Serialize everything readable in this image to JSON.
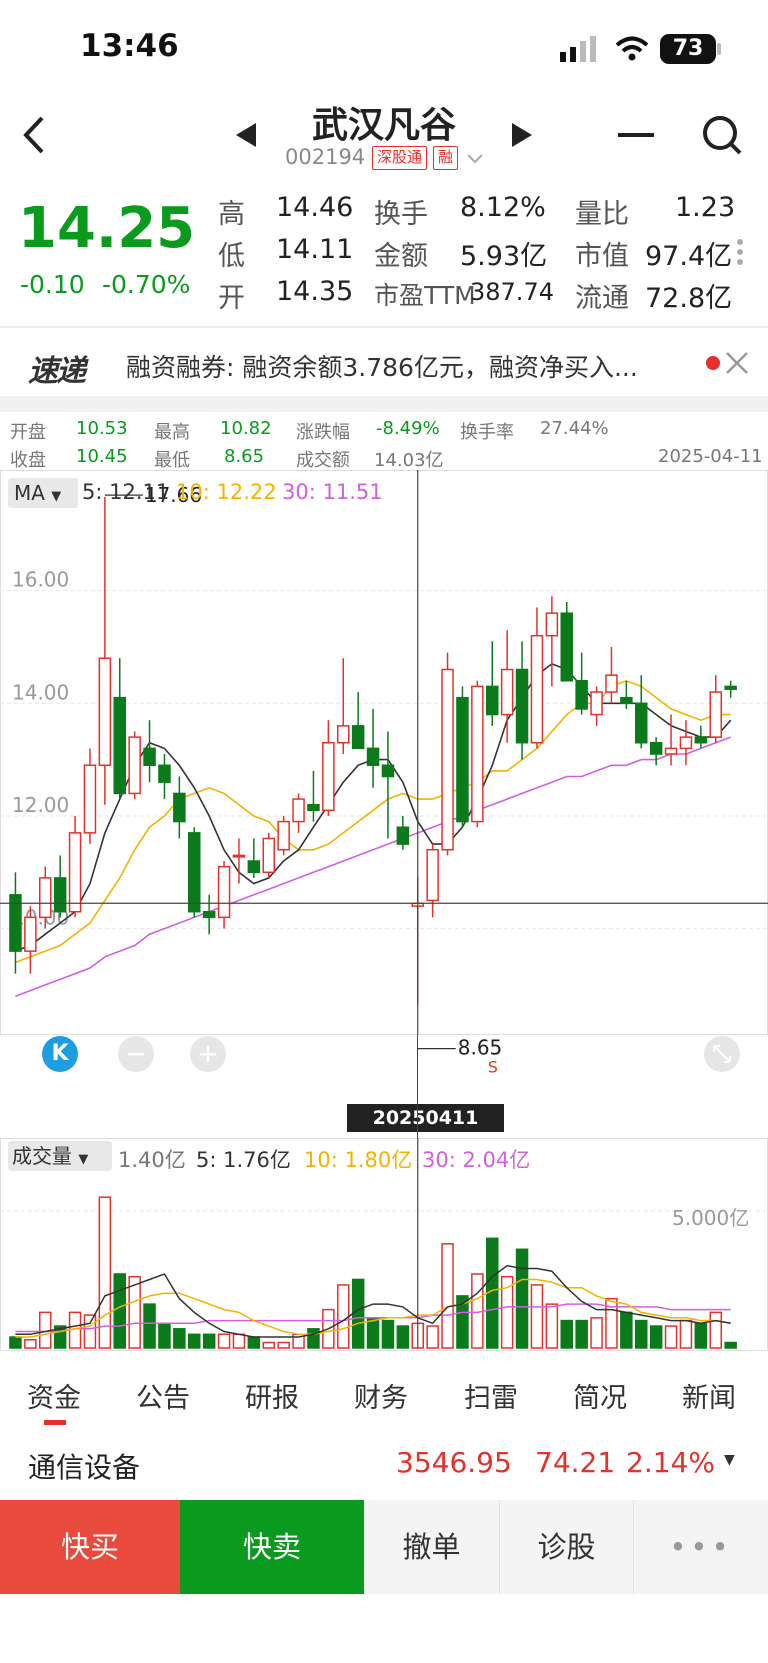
{
  "status": {
    "time": "13:46",
    "battery": "73"
  },
  "header": {
    "title": "武汉凡谷",
    "code": "002194",
    "tag1": "深股通",
    "tag2": "融"
  },
  "quote": {
    "price": "14.25",
    "change": "-0.10",
    "change_pct": "-0.70%",
    "rows": [
      [
        {
          "label": "高",
          "value": "14.46",
          "color": "red"
        },
        {
          "label": "换手",
          "value": "8.12%"
        },
        {
          "label": "量比",
          "value": "1.23"
        }
      ],
      [
        {
          "label": "低",
          "value": "14.11",
          "color": "green"
        },
        {
          "label": "金额",
          "value": "5.93亿"
        },
        {
          "label": "市值",
          "value": "97.4亿"
        }
      ],
      [
        {
          "label": "开",
          "value": "14.35",
          "color": "dark"
        },
        {
          "label": "市盈TTM",
          "value": "387.74"
        },
        {
          "label": "流通",
          "value": "72.8亿"
        }
      ]
    ]
  },
  "news": {
    "badge": "速递",
    "text": "融资融券: 融资余额3.786亿元，融资净买入..."
  },
  "dayinfo": {
    "open_label": "开盘",
    "open": "10.53",
    "high_label": "最高",
    "high": "10.82",
    "chg_label": "涨跌幅",
    "chg": "-8.49%",
    "turn_label": "换手率",
    "turn": "27.44%",
    "close_label": "收盘",
    "close": "10.45",
    "low_label": "最低",
    "low": "8.65",
    "amt_label": "成交额",
    "amt": "14.03亿",
    "date": "2025-04-11"
  },
  "ma": {
    "btn": "MA",
    "ma5": "5: 12.11",
    "ma10": "10: 12.22",
    "ma30": "30: 11.51",
    "max_label": "17.66",
    "min_label": "8.65",
    "s_mark": "S",
    "cross_date": "20250411"
  },
  "volume": {
    "btn": "成交量",
    "cur": "1.40亿",
    "v5": "5: 1.76亿",
    "v10": "10: 1.80亿",
    "v30": "30: 2.04亿",
    "scale": "5.000亿"
  },
  "colors": {
    "up": "#e5312c",
    "down": "#0a7a1a",
    "ma5": "#333333",
    "ma10": "#f0b400",
    "ma30": "#d060e0"
  },
  "chart_data": {
    "type": "candlestick",
    "ylim": [
      8.2,
      18.0
    ],
    "yticks": [
      "16.00",
      "14.00",
      "12.00",
      "10.00"
    ],
    "candles": [
      [
        10.6,
        11.0,
        9.2,
        9.6
      ],
      [
        9.6,
        10.4,
        9.2,
        10.2
      ],
      [
        10.2,
        11.1,
        10.0,
        10.9
      ],
      [
        10.9,
        11.3,
        10.2,
        10.3
      ],
      [
        10.3,
        12.0,
        10.2,
        11.7
      ],
      [
        11.7,
        13.2,
        11.5,
        12.9
      ],
      [
        12.9,
        17.66,
        12.2,
        14.8
      ],
      [
        14.1,
        14.8,
        12.3,
        12.4
      ],
      [
        12.4,
        13.5,
        12.3,
        13.4
      ],
      [
        13.2,
        13.7,
        12.6,
        12.9
      ],
      [
        12.9,
        13.1,
        12.3,
        12.6
      ],
      [
        12.4,
        12.7,
        11.6,
        11.9
      ],
      [
        11.7,
        11.8,
        10.2,
        10.3
      ],
      [
        10.3,
        10.6,
        9.9,
        10.2
      ],
      [
        10.2,
        11.2,
        10.0,
        11.1
      ],
      [
        11.3,
        11.6,
        10.8,
        11.3
      ],
      [
        11.2,
        11.6,
        10.9,
        11.0
      ],
      [
        11.0,
        11.7,
        10.9,
        11.6
      ],
      [
        11.4,
        12.0,
        11.3,
        11.9
      ],
      [
        11.9,
        12.4,
        11.7,
        12.3
      ],
      [
        12.2,
        12.8,
        11.9,
        12.1
      ],
      [
        12.1,
        13.7,
        12.0,
        13.3
      ],
      [
        13.3,
        14.8,
        13.1,
        13.6
      ],
      [
        13.6,
        14.2,
        13.2,
        13.2
      ],
      [
        13.2,
        13.9,
        12.5,
        12.9
      ],
      [
        12.9,
        13.5,
        11.6,
        12.7
      ],
      [
        11.8,
        12.0,
        11.4,
        11.5
      ],
      [
        10.4,
        10.9,
        8.65,
        10.45
      ],
      [
        10.5,
        11.5,
        10.2,
        11.4
      ],
      [
        11.4,
        14.9,
        11.3,
        14.6
      ],
      [
        14.1,
        14.3,
        11.8,
        11.9
      ],
      [
        11.9,
        14.4,
        11.8,
        14.3
      ],
      [
        14.3,
        15.1,
        13.6,
        13.8
      ],
      [
        13.8,
        15.3,
        13.3,
        14.6
      ],
      [
        14.6,
        15.1,
        13.0,
        13.3
      ],
      [
        13.3,
        15.7,
        13.2,
        15.2
      ],
      [
        15.2,
        15.9,
        14.3,
        15.6
      ],
      [
        15.6,
        15.8,
        14.4,
        14.4
      ],
      [
        14.4,
        14.9,
        13.8,
        13.9
      ],
      [
        13.8,
        14.3,
        13.6,
        14.2
      ],
      [
        14.2,
        15.0,
        14.0,
        14.5
      ],
      [
        14.1,
        14.4,
        13.9,
        14.0
      ],
      [
        14.0,
        14.5,
        13.2,
        13.3
      ],
      [
        13.3,
        13.4,
        12.9,
        13.1
      ],
      [
        13.1,
        13.8,
        12.9,
        13.2
      ],
      [
        13.2,
        13.7,
        12.9,
        13.4
      ],
      [
        13.4,
        13.6,
        13.2,
        13.3
      ],
      [
        13.4,
        14.5,
        13.3,
        14.2
      ],
      [
        14.3,
        14.4,
        14.1,
        14.25
      ]
    ],
    "ma5": [
      9.6,
      9.7,
      9.9,
      10.1,
      10.3,
      10.8,
      11.7,
      12.3,
      12.9,
      13.3,
      13.2,
      12.9,
      12.5,
      12.0,
      11.4,
      11.0,
      10.8,
      10.9,
      11.2,
      11.4,
      11.8,
      12.2,
      12.6,
      12.9,
      13.0,
      13.0,
      12.6,
      11.9,
      11.5,
      11.5,
      11.8,
      12.3,
      12.9,
      13.7,
      14.1,
      14.5,
      14.7,
      14.6,
      14.3,
      14.0,
      14.0,
      14.0,
      14.0,
      13.8,
      13.6,
      13.5,
      13.4,
      13.4,
      13.7
    ],
    "ma10": [
      9.4,
      9.5,
      9.6,
      9.7,
      9.9,
      10.1,
      10.5,
      10.9,
      11.4,
      11.8,
      12.0,
      12.3,
      12.4,
      12.5,
      12.4,
      12.2,
      12.0,
      11.9,
      11.6,
      11.4,
      11.4,
      11.5,
      11.7,
      11.9,
      12.1,
      12.3,
      12.4,
      12.3,
      12.3,
      12.4,
      12.5,
      12.6,
      12.8,
      12.8,
      13.0,
      13.2,
      13.5,
      13.8,
      14.0,
      14.0,
      14.3,
      14.4,
      14.3,
      14.1,
      13.9,
      13.8,
      13.7,
      13.8,
      13.8
    ],
    "ma30": [
      8.8,
      8.9,
      9.0,
      9.1,
      9.2,
      9.3,
      9.5,
      9.6,
      9.7,
      9.9,
      10.0,
      10.1,
      10.2,
      10.3,
      10.4,
      10.5,
      10.6,
      10.7,
      10.8,
      10.9,
      11.0,
      11.1,
      11.2,
      11.3,
      11.4,
      11.5,
      11.6,
      11.7,
      11.8,
      11.9,
      12.0,
      12.1,
      12.2,
      12.3,
      12.4,
      12.5,
      12.6,
      12.7,
      12.7,
      12.8,
      12.9,
      12.9,
      13.0,
      13.0,
      13.1,
      13.1,
      13.2,
      13.3,
      13.4
    ],
    "volume": [
      0.4,
      0.3,
      1.3,
      0.8,
      1.3,
      1.2,
      5.5,
      2.7,
      2.6,
      1.6,
      0.9,
      0.7,
      0.5,
      0.5,
      0.5,
      0.5,
      0.4,
      0.2,
      0.2,
      0.5,
      0.7,
      1.4,
      2.3,
      2.5,
      1.1,
      1.0,
      0.8,
      0.9,
      0.8,
      3.8,
      1.9,
      2.7,
      4.0,
      2.6,
      3.6,
      2.3,
      1.6,
      1.0,
      1.0,
      1.1,
      1.8,
      1.3,
      1.0,
      0.8,
      0.8,
      1.0,
      0.9,
      1.3,
      0.2
    ],
    "vol_ma5": [
      0.5,
      0.5,
      0.6,
      0.7,
      0.8,
      0.9,
      1.9,
      2.1,
      2.3,
      2.5,
      2.7,
      1.8,
      1.3,
      0.9,
      0.6,
      0.5,
      0.4,
      0.4,
      0.4,
      0.4,
      0.5,
      0.7,
      1.0,
      1.4,
      1.6,
      1.6,
      1.5,
      1.1,
      0.9,
      1.5,
      1.6,
      2.0,
      2.6,
      3.0,
      2.9,
      2.9,
      2.8,
      2.2,
      1.7,
      1.4,
      1.4,
      1.3,
      1.2,
      1.1,
      1.0,
      1.0,
      0.9,
      1.0,
      0.9
    ],
    "vol_ma10": [
      0.4,
      0.4,
      0.5,
      0.6,
      0.7,
      0.8,
      1.2,
      1.5,
      1.7,
      1.9,
      2.0,
      2.0,
      1.8,
      1.6,
      1.4,
      1.3,
      1.0,
      0.8,
      0.6,
      0.5,
      0.5,
      0.6,
      0.7,
      0.9,
      1.0,
      1.1,
      1.1,
      1.2,
      1.2,
      1.5,
      1.6,
      1.8,
      2.1,
      2.2,
      2.5,
      2.5,
      2.4,
      2.2,
      2.2,
      1.9,
      1.7,
      1.6,
      1.3,
      1.2,
      1.1,
      1.1,
      1.0,
      1.0,
      0.9
    ],
    "vol_ma30": [
      0.6,
      0.6,
      0.6,
      0.6,
      0.7,
      0.7,
      0.8,
      0.8,
      0.9,
      0.9,
      0.9,
      0.9,
      0.9,
      1.0,
      1.0,
      1.0,
      1.0,
      1.0,
      1.0,
      1.0,
      1.0,
      1.0,
      1.0,
      1.1,
      1.1,
      1.1,
      1.1,
      1.1,
      1.2,
      1.2,
      1.3,
      1.3,
      1.4,
      1.5,
      1.5,
      1.5,
      1.5,
      1.6,
      1.6,
      1.6,
      1.5,
      1.5,
      1.5,
      1.5,
      1.4,
      1.4,
      1.4,
      1.4,
      1.4
    ],
    "cross_index": 27,
    "cross_price": 10.45
  },
  "tabs": [
    "资金",
    "公告",
    "研报",
    "财务",
    "扫雷",
    "简况",
    "新闻"
  ],
  "industry": {
    "name": "通信设备",
    "value": "3546.95",
    "change": "74.21",
    "pct": "2.14%"
  },
  "actions": {
    "buy": "快买",
    "sell": "快卖",
    "cancel": "撤单",
    "diag": "诊股",
    "more": "•••"
  }
}
